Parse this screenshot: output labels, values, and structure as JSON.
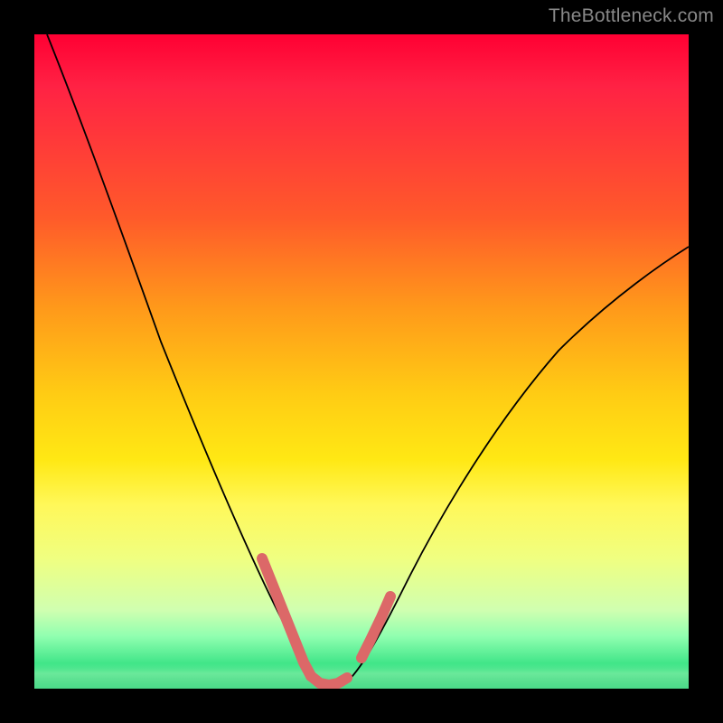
{
  "watermark": "TheBottleneck.com",
  "chart_data": {
    "type": "line",
    "title": "",
    "xlabel": "",
    "ylabel": "",
    "xlim": [
      0,
      100
    ],
    "ylim": [
      0,
      100
    ],
    "series": [
      {
        "name": "bottleneck-curve",
        "x": [
          2,
          6,
          10,
          14,
          18,
          22,
          26,
          30,
          34,
          37,
          39.5,
          41,
          43,
          45,
          47,
          49,
          52,
          56,
          62,
          70,
          80,
          90,
          100
        ],
        "values": [
          100,
          89,
          78,
          67,
          57,
          48,
          39,
          30,
          22,
          14,
          8,
          4,
          1,
          1,
          2,
          5,
          10,
          18,
          28,
          40,
          52,
          61,
          68
        ]
      }
    ],
    "markers": {
      "left_segment": {
        "x": [
          34,
          37,
          39.5,
          41
        ],
        "values": [
          22,
          14,
          8,
          4
        ]
      },
      "bottom_segment": {
        "x": [
          41,
          43,
          45,
          47
        ],
        "values": [
          4,
          1,
          1,
          2
        ]
      },
      "right_segment": {
        "x": [
          49,
          51,
          53
        ],
        "values": [
          5,
          9,
          13
        ]
      }
    },
    "gradient": {
      "top": "#ff0033",
      "mid": "#ffe814",
      "bottom": "#20c870"
    }
  }
}
